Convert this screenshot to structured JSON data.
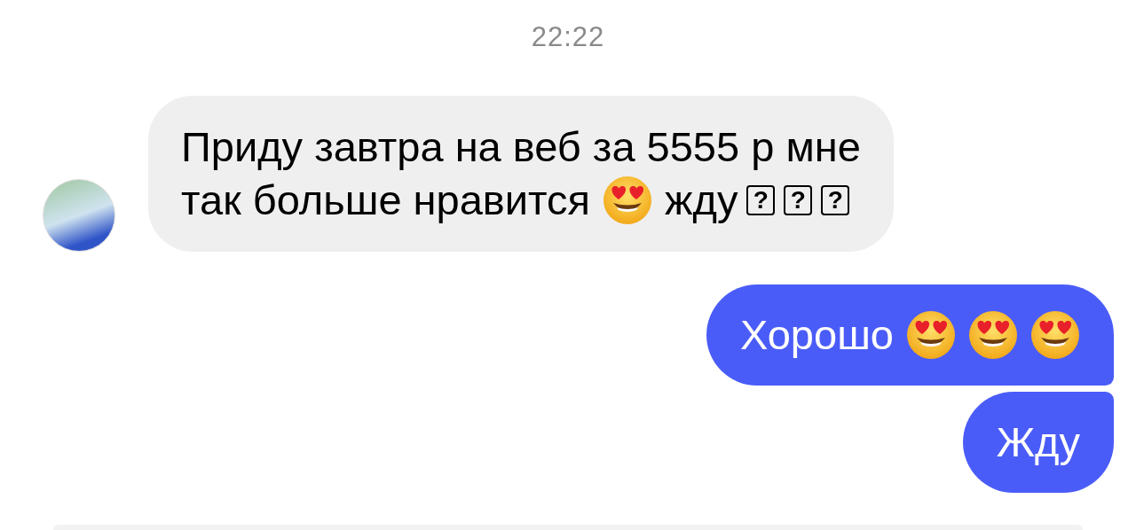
{
  "timestamp": "22:22",
  "messages": [
    {
      "kind": "incoming",
      "lines": [
        [
          {
            "kind": "text",
            "text": "Приду завтра на веб за 5555 р мне"
          }
        ],
        [
          {
            "kind": "text",
            "text": "так больше нравится"
          },
          {
            "kind": "emoji"
          },
          {
            "kind": "text",
            "text": "жду"
          },
          {
            "kind": "missing",
            "text": "?"
          },
          {
            "kind": "missing",
            "text": "?"
          },
          {
            "kind": "missing",
            "text": "?"
          }
        ]
      ]
    },
    {
      "kind": "outgoing",
      "lines": [
        [
          {
            "kind": "text",
            "text": "Хорошо"
          },
          {
            "kind": "emoji"
          },
          {
            "kind": "emoji"
          },
          {
            "kind": "emoji"
          }
        ]
      ]
    },
    {
      "kind": "outgoing",
      "lines": [
        [
          {
            "kind": "text",
            "text": "Жду"
          }
        ]
      ]
    }
  ]
}
